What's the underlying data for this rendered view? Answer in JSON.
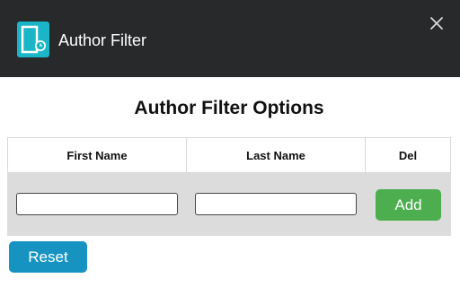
{
  "window": {
    "title": "Author Filter",
    "icon": "document-clock-icon",
    "close_icon": "close-icon"
  },
  "main": {
    "heading": "Author Filter Options",
    "table": {
      "columns": [
        "First Name",
        "Last Name",
        "Del"
      ],
      "row": {
        "first_name_value": "",
        "last_name_value": "",
        "add_label": "Add"
      }
    },
    "reset_label": "Reset"
  },
  "colors": {
    "titlebar": "#27292b",
    "icon_accent": "#1ab5c6",
    "add_button": "#4cae4f",
    "reset_button": "#1793c2",
    "row_background": "#dcdcdc"
  }
}
